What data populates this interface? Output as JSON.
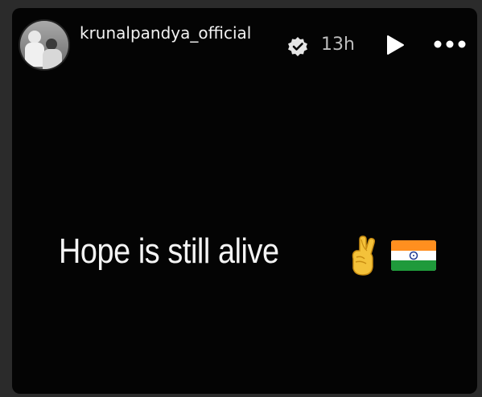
{
  "header": {
    "username": "krunalpandya_official",
    "time_ago": "13h",
    "verified_icon": "verified-badge-icon",
    "play_icon": "play-icon",
    "more_icon": "more-dots-icon"
  },
  "story": {
    "caption": "Hope is still alive",
    "emojis": [
      "crossed-fingers-icon",
      "india-flag-icon"
    ]
  },
  "colors": {
    "background": "#040404",
    "text": "#f4f4f4",
    "secondary_text": "#bdbdbd"
  }
}
